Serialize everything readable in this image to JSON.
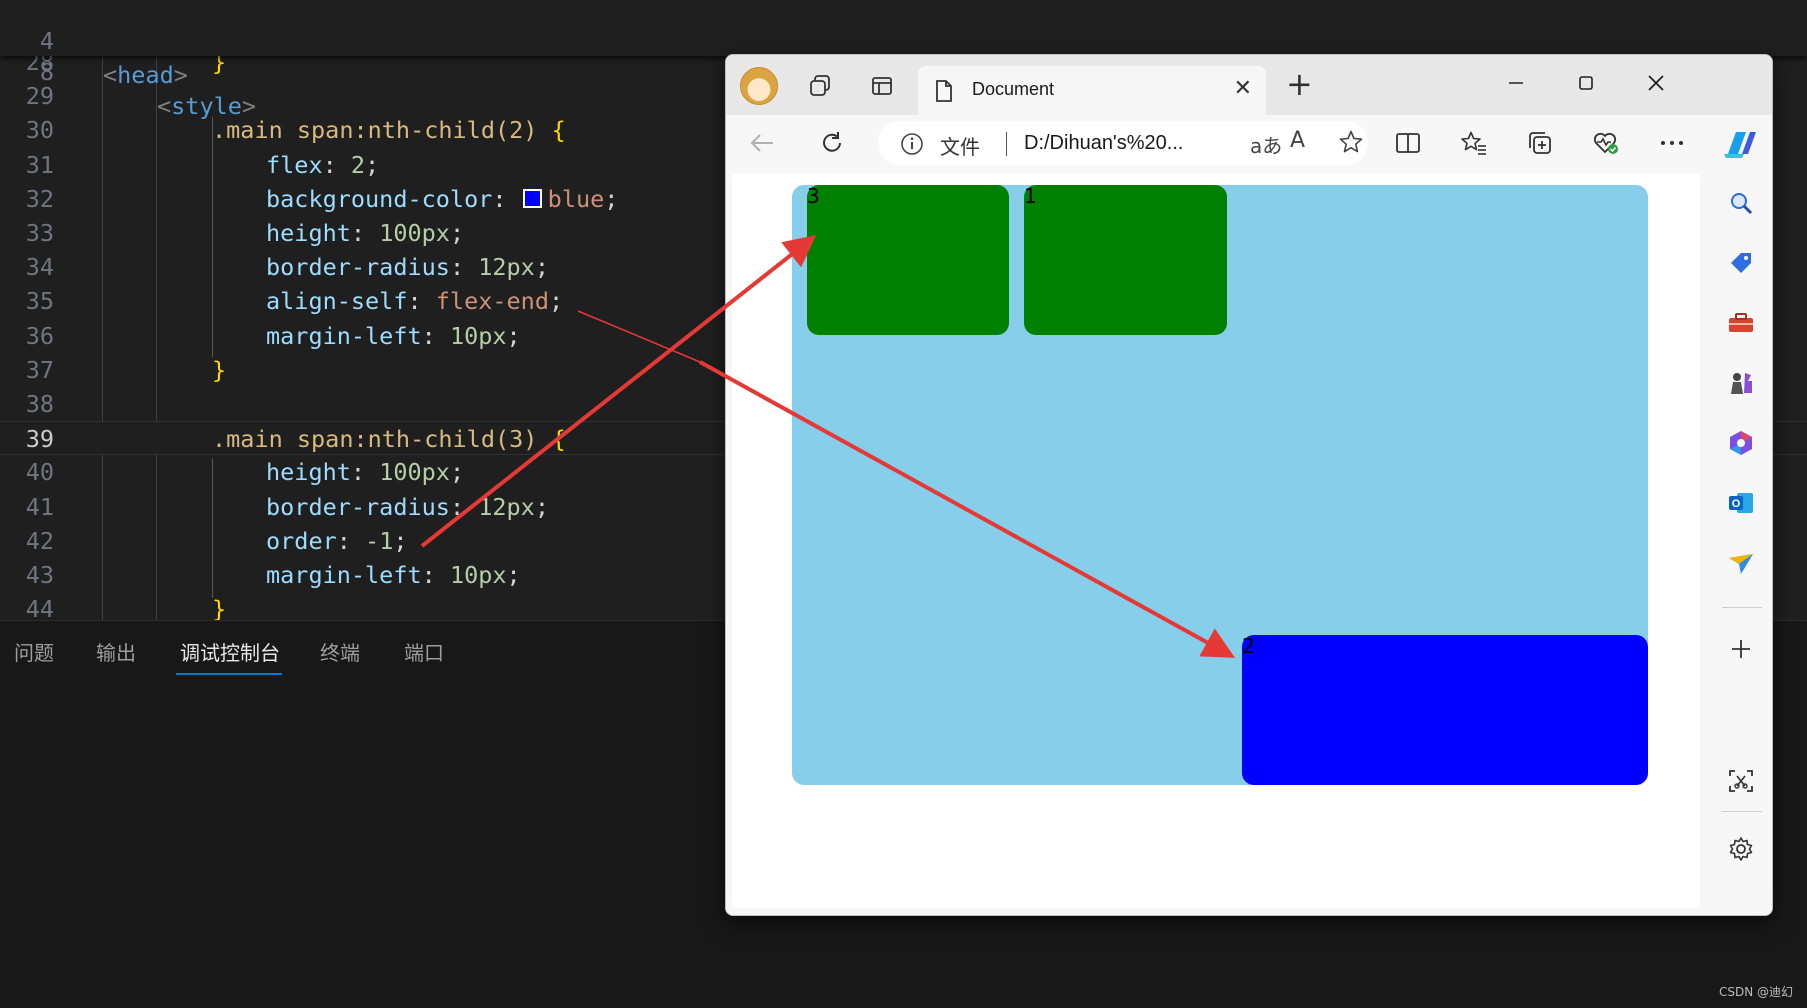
{
  "editor": {
    "sticky": [
      {
        "ln": "4",
        "open": "<",
        "tag": "head",
        "close": ">"
      },
      {
        "ln": "8",
        "open": "<",
        "tag": "style",
        "close": ">"
      }
    ],
    "lines": [
      {
        "ln": "28",
        "brace": "}"
      },
      {
        "ln": "29"
      },
      {
        "ln": "30",
        "sel": ".main span:nth-child(2) ",
        "brace": "{"
      },
      {
        "ln": "31",
        "prop": "flex",
        "val": "2"
      },
      {
        "ln": "32",
        "prop": "background-color",
        "val": "blue",
        "swatch": "#0000ff"
      },
      {
        "ln": "33",
        "prop": "height",
        "val": "100px"
      },
      {
        "ln": "34",
        "prop": "border-radius",
        "val": "12px"
      },
      {
        "ln": "35",
        "prop": "align-self",
        "val": "flex-end"
      },
      {
        "ln": "36",
        "prop": "margin-left",
        "val": "10px"
      },
      {
        "ln": "37",
        "brace": "}"
      },
      {
        "ln": "38"
      },
      {
        "ln": "39",
        "sel": ".main span:nth-child(3) ",
        "brace": "{"
      },
      {
        "ln": "40",
        "prop": "height",
        "val": "100px"
      },
      {
        "ln": "41",
        "prop": "border-radius",
        "val": "12px"
      },
      {
        "ln": "42",
        "prop": "order",
        "val": "-1"
      },
      {
        "ln": "43",
        "prop": "margin-left",
        "val": "10px"
      },
      {
        "ln": "44",
        "brace": "}"
      }
    ],
    "current_line": "39"
  },
  "panel": {
    "tabs": [
      "问题",
      "输出",
      "调试控制台",
      "终端",
      "端口"
    ],
    "active_tab": "调试控制台"
  },
  "watermark": "CSDN @迪幻",
  "browser": {
    "tab_title": "Document",
    "address_label": "文件",
    "address_url": "D:/Dihuan's%20...",
    "read_mode_glyph": "aあ",
    "read_aloud_glyph": "A",
    "page": {
      "container_color": "#87ceeb",
      "boxes": [
        {
          "label": "3",
          "color": "#008000"
        },
        {
          "label": "1",
          "color": "#008000"
        },
        {
          "label": "2",
          "color": "#0000ff"
        }
      ]
    }
  },
  "colors": {
    "editor_bg": "#1f1f1f",
    "arrow": "#e53935"
  }
}
